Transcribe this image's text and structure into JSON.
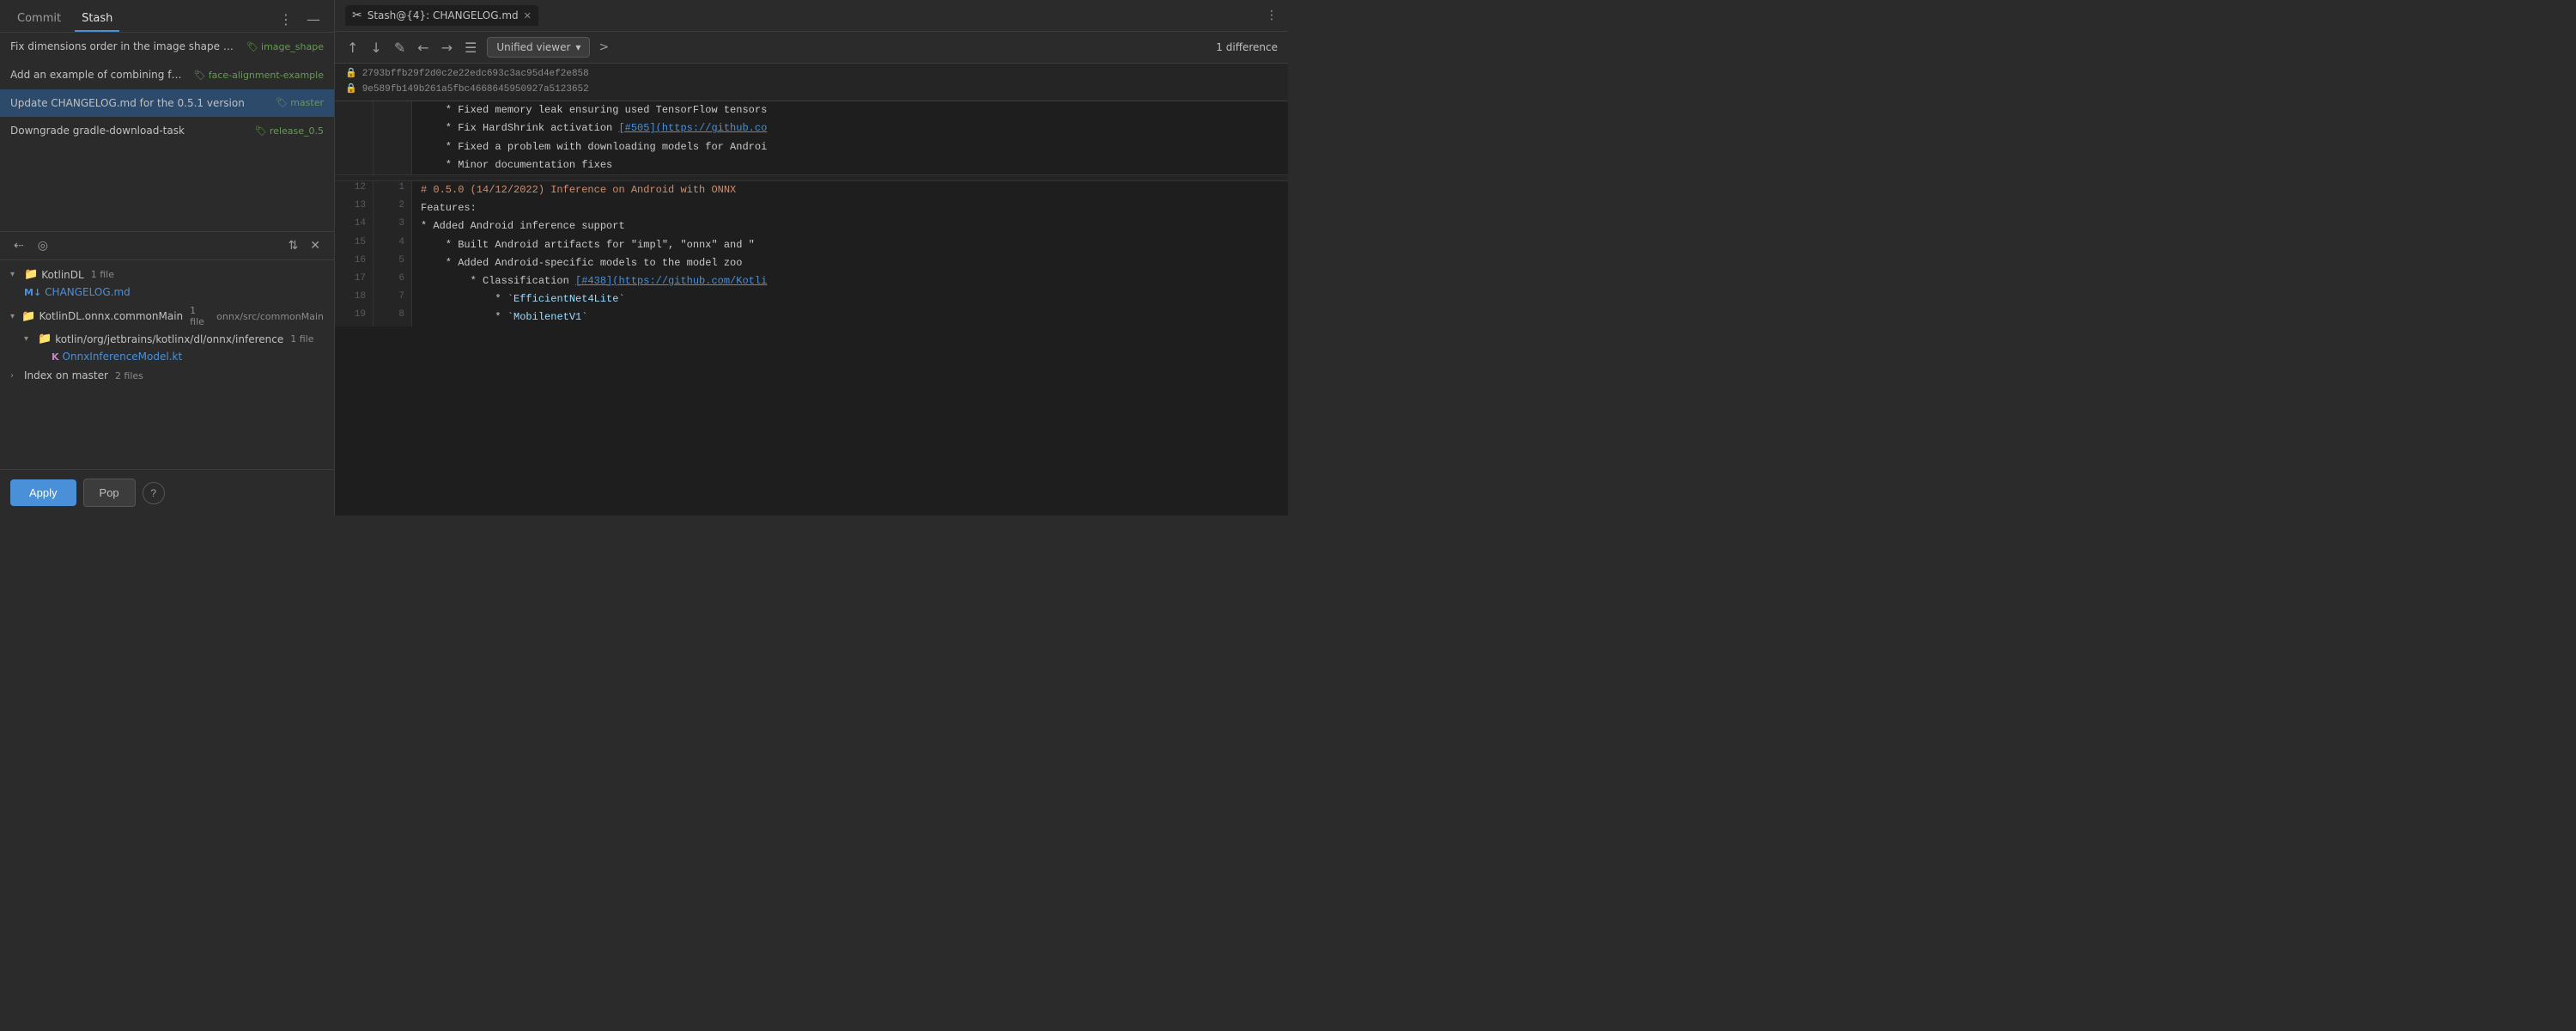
{
  "left": {
    "tabs": [
      {
        "id": "commit",
        "label": "Commit",
        "active": false
      },
      {
        "id": "stash",
        "label": "Stash",
        "active": true
      }
    ],
    "commits": [
      {
        "id": "c1",
        "text": "Fix dimensions order in the image shape produced by prepro",
        "badge": "image_shape",
        "badge_color": "green"
      },
      {
        "id": "c2",
        "text": "Add an example of combining face detection and ·",
        "badge": "face-alignment-example",
        "badge_color": "green"
      },
      {
        "id": "c3",
        "text": "Update CHANGELOG.md for the 0.5.1 version",
        "badge": "master",
        "badge_color": "green",
        "selected": true
      },
      {
        "id": "c4",
        "text": "Downgrade gradle-download-task",
        "badge": "release_0.5",
        "badge_color": "green"
      }
    ],
    "toolbar": {
      "push_icon": "←",
      "eye_icon": "👁"
    },
    "file_tree": {
      "groups": [
        {
          "id": "g1",
          "module": "KotlinDL",
          "count": "1 file",
          "expanded": true,
          "files": [
            {
              "name": "CHANGELOG.md",
              "type": "markdown",
              "icon": "M↓"
            }
          ]
        },
        {
          "id": "g2",
          "module": "KotlinDL.onnx.commonMain",
          "count": "1 file",
          "path": "onnx/src/commonMain",
          "expanded": true,
          "subfolders": [
            {
              "name": "kotlin/org/jetbrains/kotlinx/dl/onnx/inference",
              "count": "1 file",
              "expanded": true,
              "files": [
                {
                  "name": "OnnxInferenceModel.kt",
                  "type": "kotlin",
                  "icon": "K"
                }
              ]
            }
          ]
        },
        {
          "id": "g3",
          "module": "Index on master",
          "count": "2 files",
          "expanded": false
        }
      ]
    },
    "buttons": {
      "apply": "Apply",
      "pop": "Pop",
      "help": "?"
    }
  },
  "right": {
    "tab": {
      "icon": "✂",
      "label": "Stash@{4}: CHANGELOG.md"
    },
    "toolbar": {
      "up_arrow": "↑",
      "down_arrow": "↓",
      "pencil": "✎",
      "left_arrow": "←",
      "right_arrow": "→",
      "document": "☰",
      "viewer": "Unified viewer",
      "chevron": "▾",
      "expand": ">",
      "diff_count": "1 difference"
    },
    "hashes": [
      "2793bffb29f2d0c2e22edc693c3ac95d4ef2e858",
      "9e589fb149b261a5fbc4668645950927a5123652"
    ],
    "diff_lines": [
      {
        "old_num": "",
        "new_num": "",
        "type": "context",
        "content": "    * Fixed memory leak ensuring used TensorFlow tensors"
      },
      {
        "old_num": "",
        "new_num": "",
        "type": "context",
        "content": "    * Fix HardShrink activation [#505](https://github.co"
      },
      {
        "old_num": "",
        "new_num": "",
        "type": "context",
        "content": "    * Fixed a problem with downloading models for Androi"
      },
      {
        "old_num": "",
        "new_num": "",
        "type": "context",
        "content": "    * Minor documentation fixes"
      },
      {
        "old_num": "",
        "new_num": "",
        "type": "separator",
        "content": ""
      },
      {
        "old_num": "12",
        "new_num": "1",
        "type": "heading",
        "content": "# 0.5.0 (14/12/2022) Inference on Android with ONNX"
      },
      {
        "old_num": "13",
        "new_num": "2",
        "type": "context",
        "content": "Features:"
      },
      {
        "old_num": "14",
        "new_num": "3",
        "type": "context",
        "content": "* Added Android inference support"
      },
      {
        "old_num": "15",
        "new_num": "4",
        "content": "    * Built Android artifacts for \"impl\", \"onnx\" and \""
      },
      {
        "old_num": "16",
        "new_num": "5",
        "content": "    * Added Android-specific models to the model zoo"
      },
      {
        "old_num": "17",
        "new_num": "6",
        "content": "        * Classification [#438](https://github.com/Kotli"
      },
      {
        "old_num": "18",
        "new_num": "7",
        "content": "            * `EfficientNet4Lite`"
      },
      {
        "old_num": "19",
        "new_num": "8",
        "content": "            * `MobilenetV1`"
      }
    ]
  }
}
